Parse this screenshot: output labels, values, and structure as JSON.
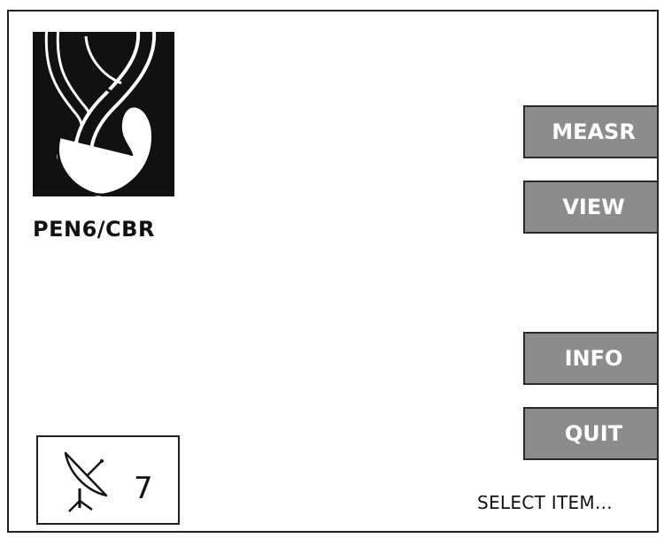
{
  "device": {
    "name": "PEN6/CBR",
    "logo_icon": "braided-strands-logo"
  },
  "menu": {
    "measure_label": "MEASR",
    "view_label": "VIEW",
    "info_label": "INFO",
    "quit_label": "QUIT"
  },
  "satellite": {
    "icon": "satellite-dish-icon",
    "count": "7"
  },
  "status": {
    "text": "SELECT ITEM..."
  },
  "colors": {
    "button_fill": "#8c8c8c",
    "button_text": "#ffffff",
    "border": "#222222",
    "logo_background": "#111111"
  }
}
